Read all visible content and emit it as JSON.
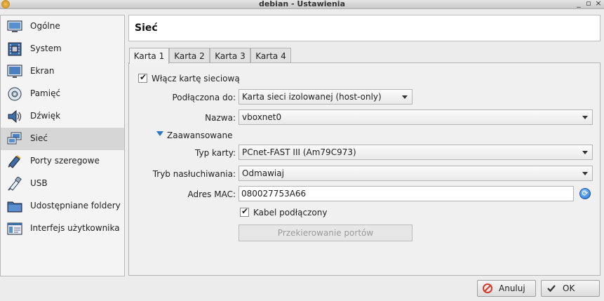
{
  "window": {
    "title": "debian - Ustawienia",
    "minimize": "_",
    "maximize": "▫",
    "close": "×"
  },
  "sidebar": {
    "items": [
      {
        "label": "Ogólne",
        "icon": "monitor-icon"
      },
      {
        "label": "System",
        "icon": "chip-icon"
      },
      {
        "label": "Ekran",
        "icon": "display-icon"
      },
      {
        "label": "Pamięć",
        "icon": "disk-icon"
      },
      {
        "label": "Dźwięk",
        "icon": "speaker-icon"
      },
      {
        "label": "Sieć",
        "icon": "network-icon"
      },
      {
        "label": "Porty szeregowe",
        "icon": "serial-port-icon"
      },
      {
        "label": "USB",
        "icon": "usb-icon"
      },
      {
        "label": "Udostępniane foldery",
        "icon": "folder-icon"
      },
      {
        "label": "Interfejs użytkownika",
        "icon": "ui-icon"
      }
    ],
    "active_index": 5
  },
  "header": {
    "title": "Sieć"
  },
  "tabs": [
    {
      "label": "Karta 1"
    },
    {
      "label": "Karta 2"
    },
    {
      "label": "Karta 3"
    },
    {
      "label": "Karta 4"
    }
  ],
  "form": {
    "enable_label": "Włącz kartę sieciową",
    "attached_label": "Podłączona do:",
    "attached_value": "Karta sieci izolowanej (host-only)",
    "name_label": "Nazwa:",
    "name_value": "vboxnet0",
    "advanced_label": "Zaawansowane",
    "adapter_type_label": "Typ karty:",
    "adapter_type_value": "PCnet-FAST III (Am79C973)",
    "promisc_label": "Tryb nasłuchiwania:",
    "promisc_value": "Odmawiaj",
    "mac_label": "Adres MAC:",
    "mac_value": "080027753A66",
    "cable_label": "Kabel podłączony",
    "port_forwarding_label": "Przekierowanie portów"
  },
  "buttons": {
    "cancel": "Anuluj",
    "ok": "OK"
  },
  "colors": {
    "accent": "#2a79c9",
    "active_sidebar": "#d6d6d6",
    "cancel_red": "#d43a2a"
  }
}
